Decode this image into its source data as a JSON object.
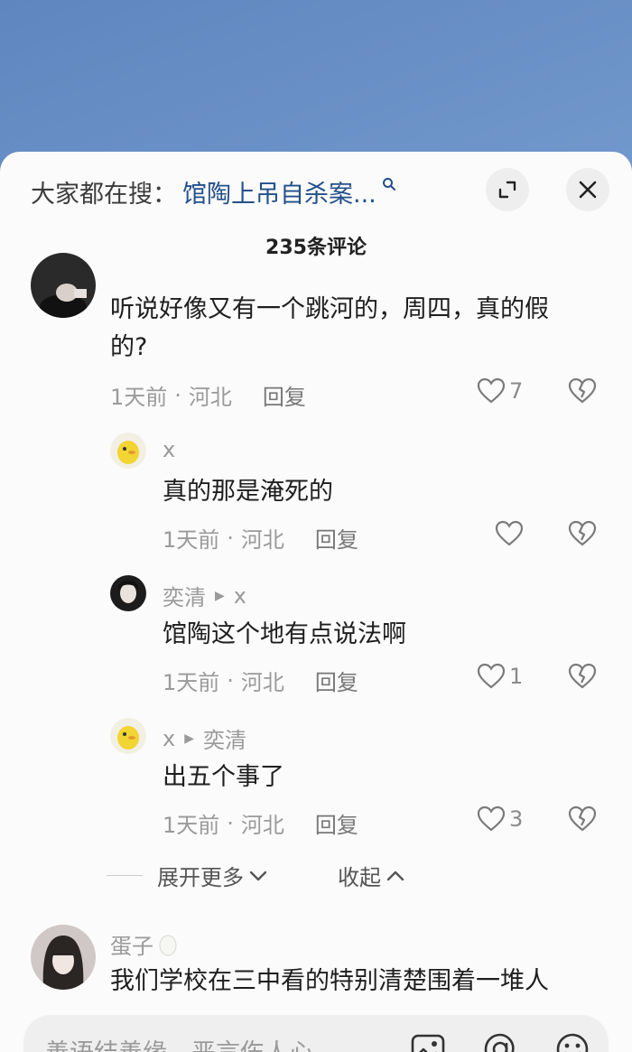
{
  "header": {
    "hot_prefix": "大家都在搜：",
    "hot_query": "馆陶上吊自杀案...",
    "comment_count": "235条评论"
  },
  "comments": [
    {
      "text_line1": "听说好像又有一个跳河的，周四，真的假",
      "text_line2": "的?",
      "time": "1天前",
      "location": "河北",
      "reply": "回复",
      "likes": "7"
    },
    {
      "user": "x",
      "text": "真的那是淹死的",
      "time": "1天前",
      "location": "河北",
      "reply": "回复",
      "likes": ""
    },
    {
      "user": "奕清",
      "reply_to": "x",
      "text": "馆陶这个地有点说法啊",
      "time": "1天前",
      "location": "河北",
      "reply": "回复",
      "likes": "1"
    },
    {
      "user": "x",
      "reply_to": "奕清",
      "text": "出五个事了",
      "time": "1天前",
      "location": "河北",
      "reply": "回复",
      "likes": "3"
    },
    {
      "user": "蛋子",
      "text": "我们学校在三中看的特别清楚围着一堆人"
    }
  ],
  "thread_controls": {
    "expand_more": "展开更多",
    "collapse": "收起"
  },
  "input": {
    "placeholder": "善语结善缘，恶言伤人心"
  },
  "colors": {
    "link": "#234f8a",
    "muted": "#9a9a9a",
    "sheet_bg": "#fbfbfb"
  }
}
